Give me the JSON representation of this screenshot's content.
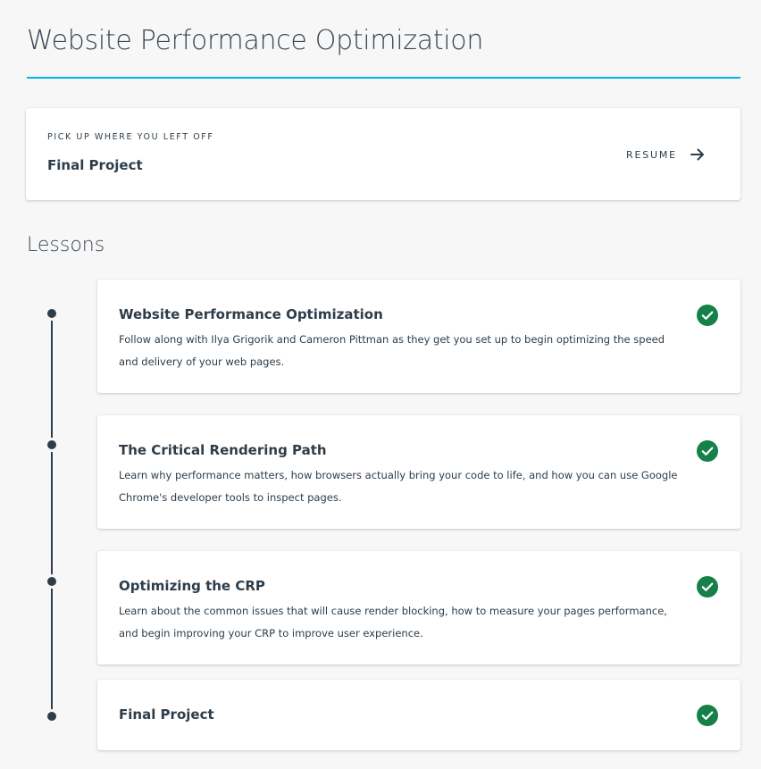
{
  "header": {
    "title": "Website Performance Optimization"
  },
  "resume": {
    "eyebrow": "PICK UP WHERE YOU LEFT OFF",
    "lesson": "Final Project",
    "button_label": "RESUME",
    "icon": "arrow-right-icon"
  },
  "lessons_section": {
    "title": "Lessons",
    "items": [
      {
        "title": "Website Performance Optimization",
        "description": "Follow along with Ilya Grigorik and Cameron Pittman as they get you set up to begin optimizing the speed and delivery of your web pages.",
        "completed": true
      },
      {
        "title": "The Critical Rendering Path",
        "description": "Learn why performance matters, how browsers actually bring your code to life, and how you can use Google Chrome's developer tools to inspect pages.",
        "completed": true
      },
      {
        "title": "Optimizing the CRP",
        "description": "Learn about the common issues that will cause render blocking, how to measure your pages performance, and begin improving your CRP to improve user experience.",
        "completed": true
      },
      {
        "title": "Final Project",
        "description": "",
        "completed": true
      }
    ]
  },
  "colors": {
    "accent": "#02b3e4",
    "complete": "#15804a",
    "text": "#2e3d49",
    "background": "#f7f7f7"
  }
}
